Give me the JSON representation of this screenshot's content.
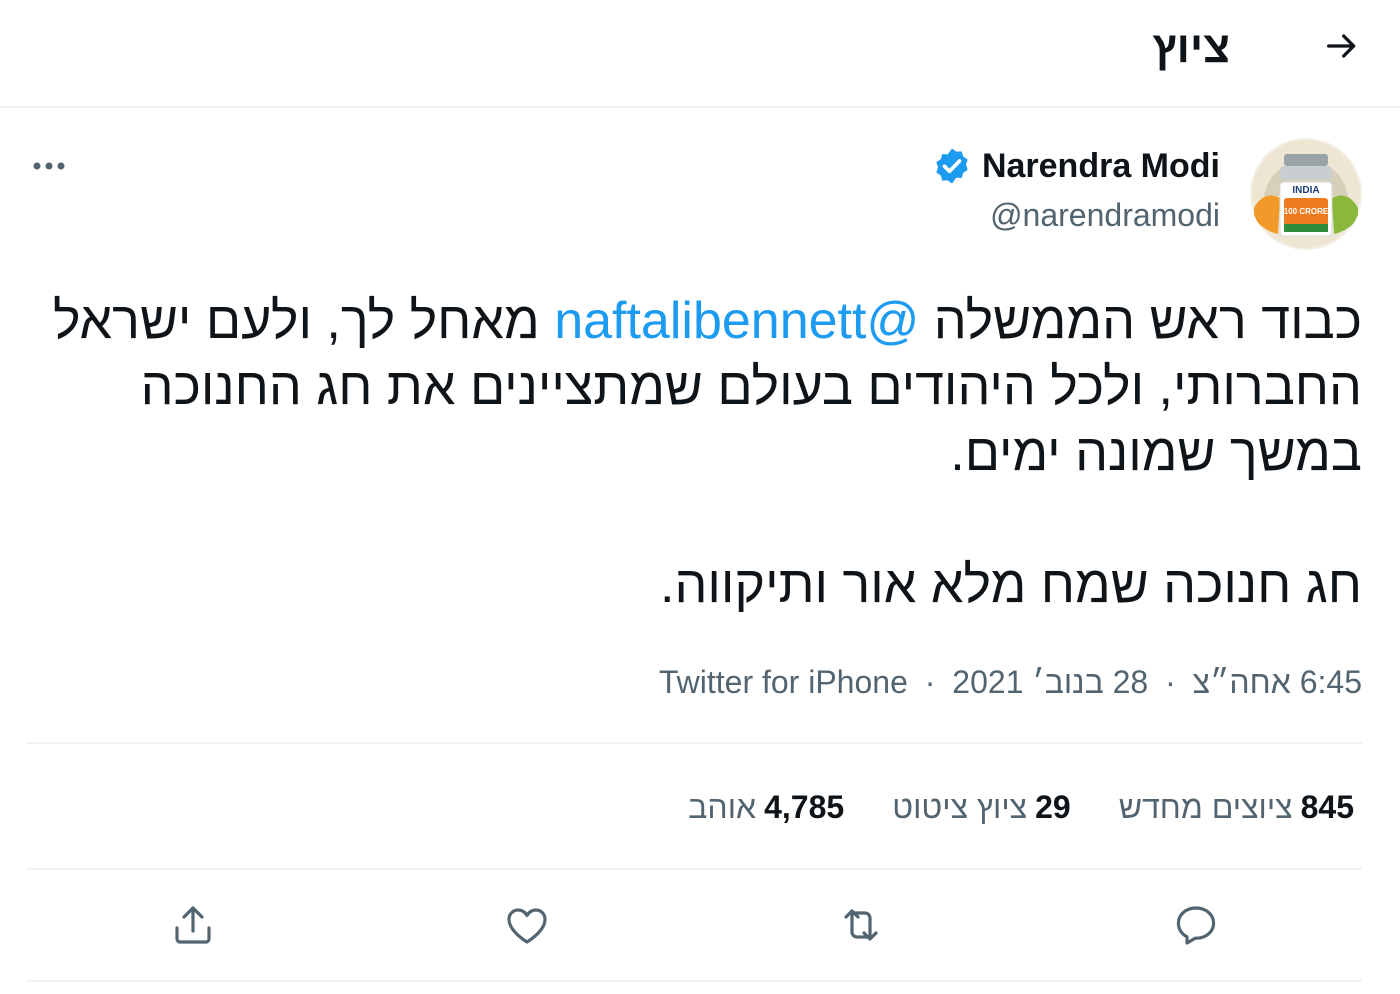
{
  "header": {
    "title": "ציוץ",
    "back_icon": "arrow-right-icon"
  },
  "author": {
    "name": "Narendra Modi",
    "handle": "@narendramodi",
    "verified_icon": "verified-badge-icon",
    "avatar_text_top": "INDIA",
    "avatar_text_mid": "100 CRORE"
  },
  "tweet": {
    "text_line1_before": "כבוד ראש הממשלה ",
    "mention": "@naftalibennett",
    "text_line1_after": " מאחל לך, ולעם ישראל החברותי, ולכל היהודים בעולם שמתציינים את חג החנוכה במשך שמונה ימים.",
    "text_para2": "חג חנוכה שמח מלא אור ותיקווה."
  },
  "meta": {
    "time": "6:45 אחה״צ",
    "date": "28 בנוב׳ 2021",
    "source": "Twitter for iPhone",
    "separator": "·"
  },
  "stats": {
    "retweets_count": "845",
    "retweets_label": "ציוצים מחדש",
    "quotes_count": "29",
    "quotes_label": "ציוץ ציטוט",
    "likes_count": "4,785",
    "likes_label": "אוהב"
  },
  "colors": {
    "accent": "#1d9bf0",
    "text": "#0f1419",
    "secondary": "#536471",
    "divider": "#eff3f4"
  }
}
